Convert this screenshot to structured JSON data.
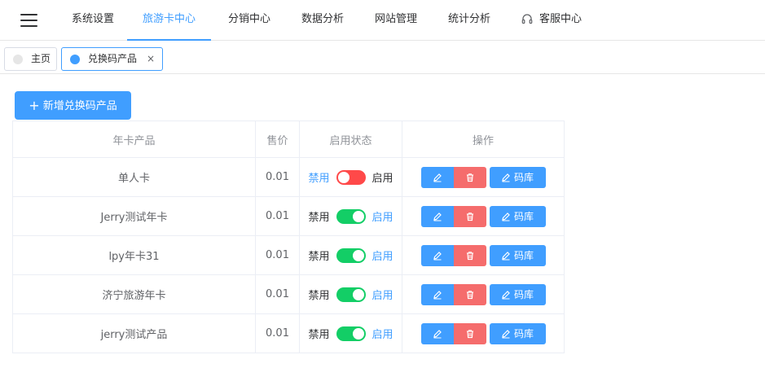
{
  "nav": {
    "items": [
      {
        "label": "系统设置"
      },
      {
        "label": "旅游卡中心"
      },
      {
        "label": "分销中心"
      },
      {
        "label": "数据分析"
      },
      {
        "label": "网站管理"
      },
      {
        "label": "统计分析"
      },
      {
        "label": "客服中心"
      }
    ],
    "active_index": 1
  },
  "tabs": [
    {
      "label": "主页"
    },
    {
      "label": "兑换码产品",
      "close": "×"
    }
  ],
  "add_button": {
    "label": "新增兑换码产品"
  },
  "table": {
    "headers": [
      "年卡产品",
      "售价",
      "启用状态",
      "操作"
    ],
    "disable_label": "禁用",
    "enable_label": "启用",
    "code_button_label": "码库",
    "rows": [
      {
        "name": "单人卡",
        "price": "0.01",
        "enabled": false
      },
      {
        "name": "Jerry测试年卡",
        "price": "0.01",
        "enabled": true
      },
      {
        "name": "lpy年卡31",
        "price": "0.01",
        "enabled": true
      },
      {
        "name": "济宁旅游年卡",
        "price": "0.01",
        "enabled": true
      },
      {
        "name": "jerry测试产品",
        "price": "0.01",
        "enabled": true
      }
    ]
  },
  "colors": {
    "accent": "#409eff",
    "switch_on": "#13ce66",
    "switch_off": "#ff4949",
    "danger": "#f56c6c"
  }
}
